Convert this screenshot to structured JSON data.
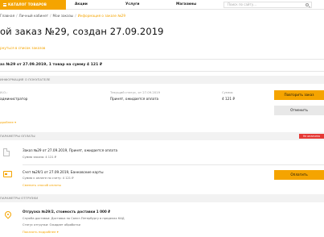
{
  "topnav": {
    "catalog": "КАТАЛОГ ТОВАРОВ",
    "items": [
      "Акции",
      "Услуги",
      "Магазины"
    ],
    "search_placeholder": "Поиск по сайту..."
  },
  "breadcrumb": {
    "items": [
      "Главная",
      "Личный кабинет",
      "Мои заказы"
    ],
    "current": "Информация о заказе №29"
  },
  "page": {
    "title": "ой заказ №29, создан 27.09.2019",
    "return_link": "рнуться в список заказов"
  },
  "summary": "аз №29 от 27.09.2019, 1 товар на сумму 4 121 ₽",
  "customer": {
    "header": "ИНФОРМАЦИЯ О ПОКУПАТЕЛЕ",
    "name_label": "И.О.:",
    "name_value": "администратор",
    "status_label": "Текущий статус, от 27.09.2019",
    "status_value": "Принят, ожидается оплата",
    "sum_label": "Сумма:",
    "sum_value": "4 121 ₽",
    "details_link": "дробнее",
    "repeat_button": "Повторить заказ",
    "cancel_button": "Отменить"
  },
  "payment": {
    "header": "ПАРАМЕТРЫ ОПЛАТЫ",
    "badge": "Не оплачено",
    "order_line": "Заказ №29 от 27.09.2019, Принят, ожидается оплата",
    "order_sum": "Сумма заказа: 4 121 ₽",
    "invoice_line": "Счет №29/1 от 27.09.2019, Банковские карты",
    "invoice_sum": "Сумма к оплате по счету: 4 121 ₽",
    "change_link": "Сменить способ оплаты",
    "pay_button": "Оплатить"
  },
  "shipment": {
    "header": "ПАРАМЕТРЫ ОТГРУЗКИ",
    "title": "Отгрузка №29/2, стоимость доставки 1 000 ₽",
    "service": "Служба доставки: Доставка по Санкт-Петербургу в пределах КАД",
    "status": "Статус отгрузки: Ожидает обработки",
    "details_link": "Показать подробнее"
  }
}
